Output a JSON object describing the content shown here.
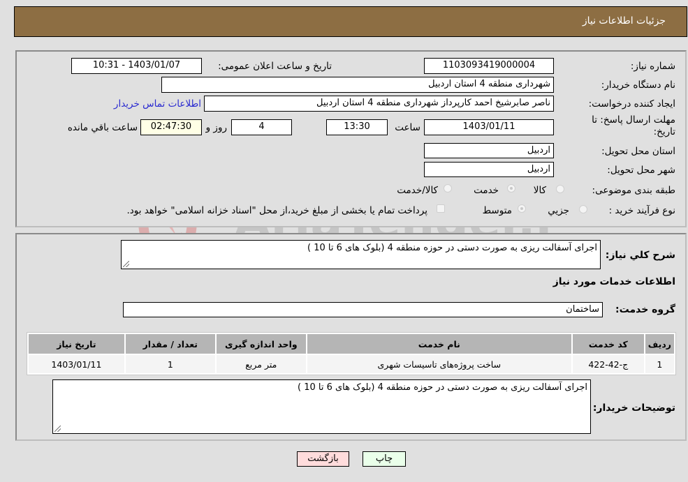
{
  "header": {
    "title": "جزئیات اطلاعات نیاز"
  },
  "form": {
    "need_number_label": "شماره نیاز:",
    "need_number": "1103093419000004",
    "announce_label": "تاریخ و ساعت اعلان عمومی:",
    "announce_value": "1403/01/07 - 10:31",
    "buyer_org_label": "نام دستگاه خریدار:",
    "buyer_org": "شهرداری منطقه 4 استان اردبیل",
    "creator_label": "ایجاد کننده درخواست:",
    "creator": "ناصر صابرشیخ احمد کارپرداز شهرداری منطقه 4 استان اردبیل",
    "contact_link": "اطلاعات تماس خریدار",
    "deadline_label": "مهلت ارسال پاسخ: تا تاریخ:",
    "deadline_date": "1403/01/11",
    "time_label": "ساعت",
    "deadline_time": "13:30",
    "days_value": "4",
    "days_label": "روز و",
    "remaining_time": "02:47:30",
    "remaining_label": "ساعت باقي مانده",
    "province_label": "استان محل تحویل:",
    "province": "اردبیل",
    "city_label": "شهر محل تحویل:",
    "city": "اردبیل",
    "category_label": "طبقه بندی موضوعی:",
    "category_options": [
      "کالا",
      "خدمت",
      "کالا/خدمت"
    ],
    "category_selected": "خدمت",
    "process_label": "نوع فرآیند خرید :",
    "process_options": [
      "جزيي",
      "متوسط"
    ],
    "process_selected": "متوسط",
    "treasury_note": "پرداخت تمام یا بخشی از مبلغ خرید،از محل \"اسناد خزانه اسلامی\" خواهد بود."
  },
  "details": {
    "summary_label": "شرح کلي نياز:",
    "summary": "اجرای آسفالت ریزی به صورت دستی در حوزه منطقه 4 (بلوک های 6 تا 10 )",
    "services_heading": "اطلاعات خدمات مورد نیاز",
    "service_group_label": "گروه خدمت:",
    "service_group": "ساختمان",
    "table": {
      "headers": [
        "ردیف",
        "کد خدمت",
        "نام خدمت",
        "واحد اندازه گیری",
        "تعداد / مقدار",
        "تاریخ نیاز"
      ],
      "rows": [
        [
          "1",
          "ج-42-422",
          "ساخت پروژه‌های تاسیسات شهری",
          "متر مربع",
          "1",
          "1403/01/11"
        ]
      ]
    },
    "buyer_notes_label": "توضیحات خریدار:",
    "buyer_notes": "اجرای آسفالت ریزی به صورت دستی در حوزه منطقه 4 (بلوک های 6 تا 10 )"
  },
  "buttons": {
    "print": "چاپ",
    "back": "بازگشت"
  },
  "watermark": {
    "text": "AriaTender.neT"
  },
  "colors": {
    "header_bg": "#8d6e43",
    "print_bg": "#eaffea",
    "back_bg": "#ffdcdc",
    "link": "#2a2ad0"
  }
}
